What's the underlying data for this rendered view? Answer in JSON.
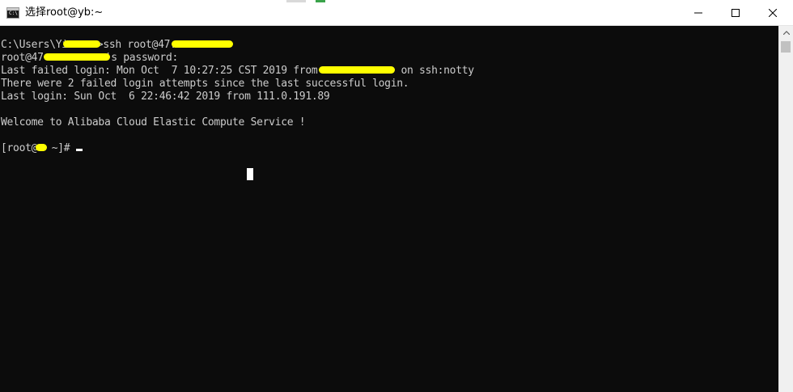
{
  "window": {
    "title": "选择root@yb:~",
    "app_icon_text": "C:\\",
    "controls": {
      "minimize_icon": "minimize-icon",
      "maximize_icon": "maximize-icon",
      "close_icon": "close-icon"
    }
  },
  "console": {
    "lines": [
      {
        "pre": "C:\\Users\\Yi",
        "post": ">ssh root@47.",
        "post2": ""
      },
      {
        "pre": "root@47",
        "post": "'s password:",
        "post2": ""
      },
      {
        "pre": "Last failed login: Mon Oct  7 10:27:25 CST 2019 from ",
        "post": " on ssh:notty",
        "post2": ""
      },
      {
        "pre": "There were 2 failed login attempts since the last successful login.",
        "post": "",
        "post2": ""
      },
      {
        "pre": "Last login: Sun Oct  6 22:46:42 2019 from 111.0.191.89",
        "post": "",
        "post2": ""
      },
      {
        "pre": "",
        "post": "",
        "post2": ""
      },
      {
        "pre": "Welcome to Alibaba Cloud Elastic Compute Service !",
        "post": "",
        "post2": ""
      },
      {
        "pre": "",
        "post": "",
        "post2": ""
      },
      {
        "pre": "[root@",
        "post": " ~]# ",
        "post2": ""
      }
    ],
    "redaction_color": "#ffff00",
    "text_color": "#cccccc",
    "background_color": "#0c0c0c"
  }
}
